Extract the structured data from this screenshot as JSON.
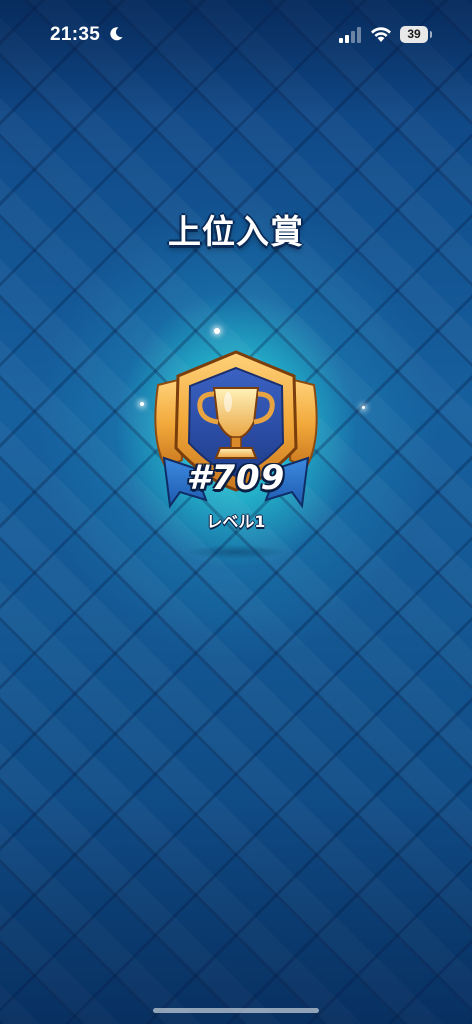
{
  "status_bar": {
    "time": "21:35",
    "battery_level": "39",
    "icons": [
      "moon-icon",
      "signal-icon",
      "wifi-icon",
      "battery-icon"
    ]
  },
  "award": {
    "title": "上位入賞",
    "rank": "#709",
    "level": "レベル1",
    "badge_icon": "trophy-icon"
  },
  "colors": {
    "background": "#145894",
    "glow": "#46f5eb",
    "badge_gold": "#f2a93b",
    "badge_blue": "#2b4fa8",
    "ribbon": "#2a6fc9"
  }
}
